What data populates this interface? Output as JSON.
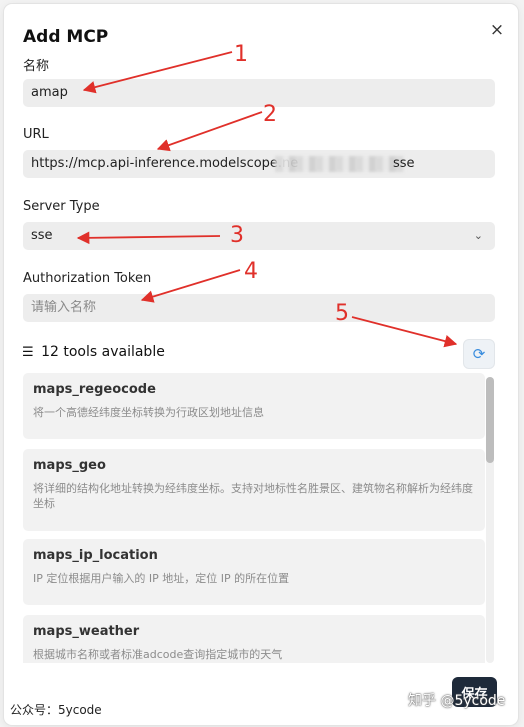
{
  "dialog": {
    "title": "Add MCP",
    "close_glyph": "×"
  },
  "fields": {
    "name": {
      "label": "名称",
      "value": "amap"
    },
    "url": {
      "label": "URL",
      "value_visible": "https://mcp.api-inference.modelscope.ne",
      "value_tail": "sse"
    },
    "server_type": {
      "label": "Server Type",
      "value": "sse",
      "chevron": "⌄"
    },
    "auth_token": {
      "label": "Authorization Token",
      "placeholder": "请输入名称"
    }
  },
  "tools": {
    "count_text": "12 tools available",
    "list_icon": "☰",
    "refresh_icon": "⟳",
    "items": [
      {
        "name": "maps_regeocode",
        "desc": "将一个高德经纬度坐标转换为行政区划地址信息"
      },
      {
        "name": "maps_geo",
        "desc": "将详细的结构化地址转换为经纬度坐标。支持对地标性名胜景区、建筑物名称解析为经纬度坐标"
      },
      {
        "name": "maps_ip_location",
        "desc": "IP 定位根据用户输入的 IP 地址，定位 IP 的所在位置"
      },
      {
        "name": "maps_weather",
        "desc": "根据城市名称或者标准adcode查询指定城市的天气"
      }
    ]
  },
  "actions": {
    "save_label": "保存"
  },
  "footer": {
    "left": "公众号：5ycode",
    "right": "知乎 @5ycode"
  },
  "annotations": {
    "labels": [
      "1",
      "2",
      "3",
      "4",
      "5"
    ],
    "color": "#e0302a"
  },
  "colors": {
    "save_bg": "#1e2a3a",
    "refresh_icon": "#3a8dde",
    "field_bg": "#ededed"
  }
}
